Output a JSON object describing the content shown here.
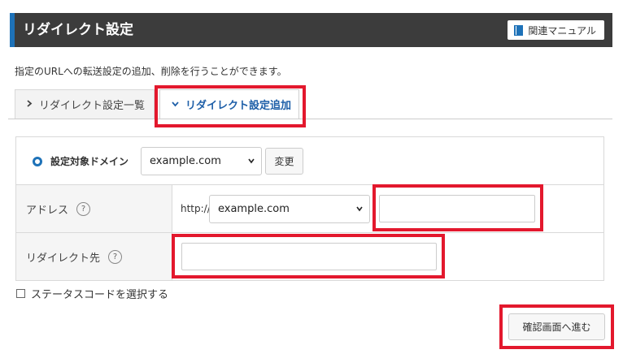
{
  "header": {
    "title": "リダイレクト設定",
    "manual_label": "関連マニュアル"
  },
  "description": "指定のURLへの転送設定の追加、削除を行うことができます。",
  "tabs": [
    {
      "label": "リダイレクト設定一覧",
      "active": false
    },
    {
      "label": "リダイレクト設定追加",
      "active": true
    }
  ],
  "domain_row": {
    "label": "設定対象ドメイン",
    "selected_domain": "example.com",
    "change_label": "変更"
  },
  "address_row": {
    "label": "アドレス",
    "help": "?",
    "protocol": "http://",
    "domain": "example.com",
    "path_value": ""
  },
  "redirect_row": {
    "label": "リダイレクト先",
    "help": "?",
    "value": ""
  },
  "status_code_checkbox": {
    "label": "ステータスコードを選択する",
    "checked": false
  },
  "confirm_button": "確認画面へ進む",
  "colors": {
    "header_bg": "#3c3c3c",
    "accent": "#1e72b8",
    "highlight": "#e3182d"
  }
}
